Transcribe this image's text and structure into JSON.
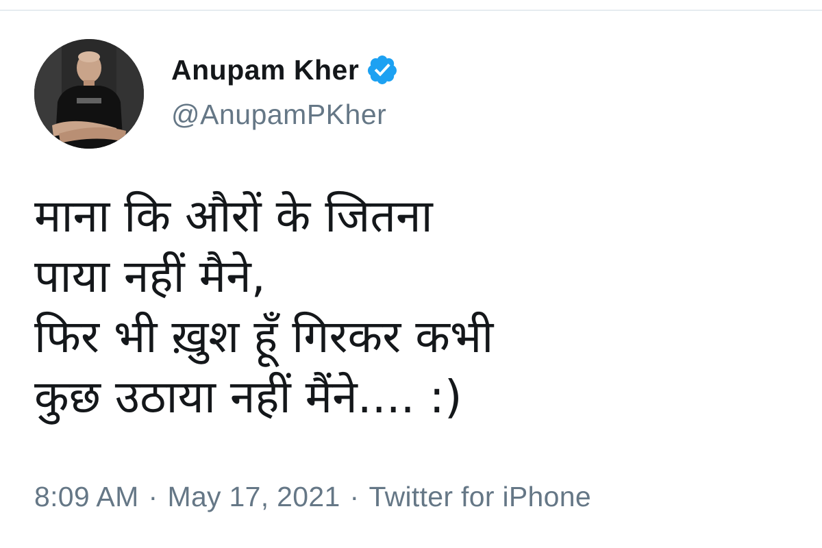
{
  "tweet": {
    "author": {
      "display_name": "Anupam Kher",
      "handle": "@AnupamPKher",
      "verified": true,
      "avatar_icon": "profile-photo",
      "verified_icon": "verified-badge-icon"
    },
    "text_lines": [
      "माना कि औरों के जितना",
      "पाया नहीं मैने,",
      "फिर भी ख़ुश हूँ गिरकर कभी",
      "कुछ उठाया नहीं मैंने.... :)"
    ],
    "time": "8:09 AM",
    "separator": "·",
    "date": "May 17, 2021",
    "source": "Twitter for iPhone"
  },
  "colors": {
    "text_primary": "#14171a",
    "text_secondary": "#657786",
    "verified_blue": "#1da1f2",
    "divider": "#e6ecf0"
  }
}
